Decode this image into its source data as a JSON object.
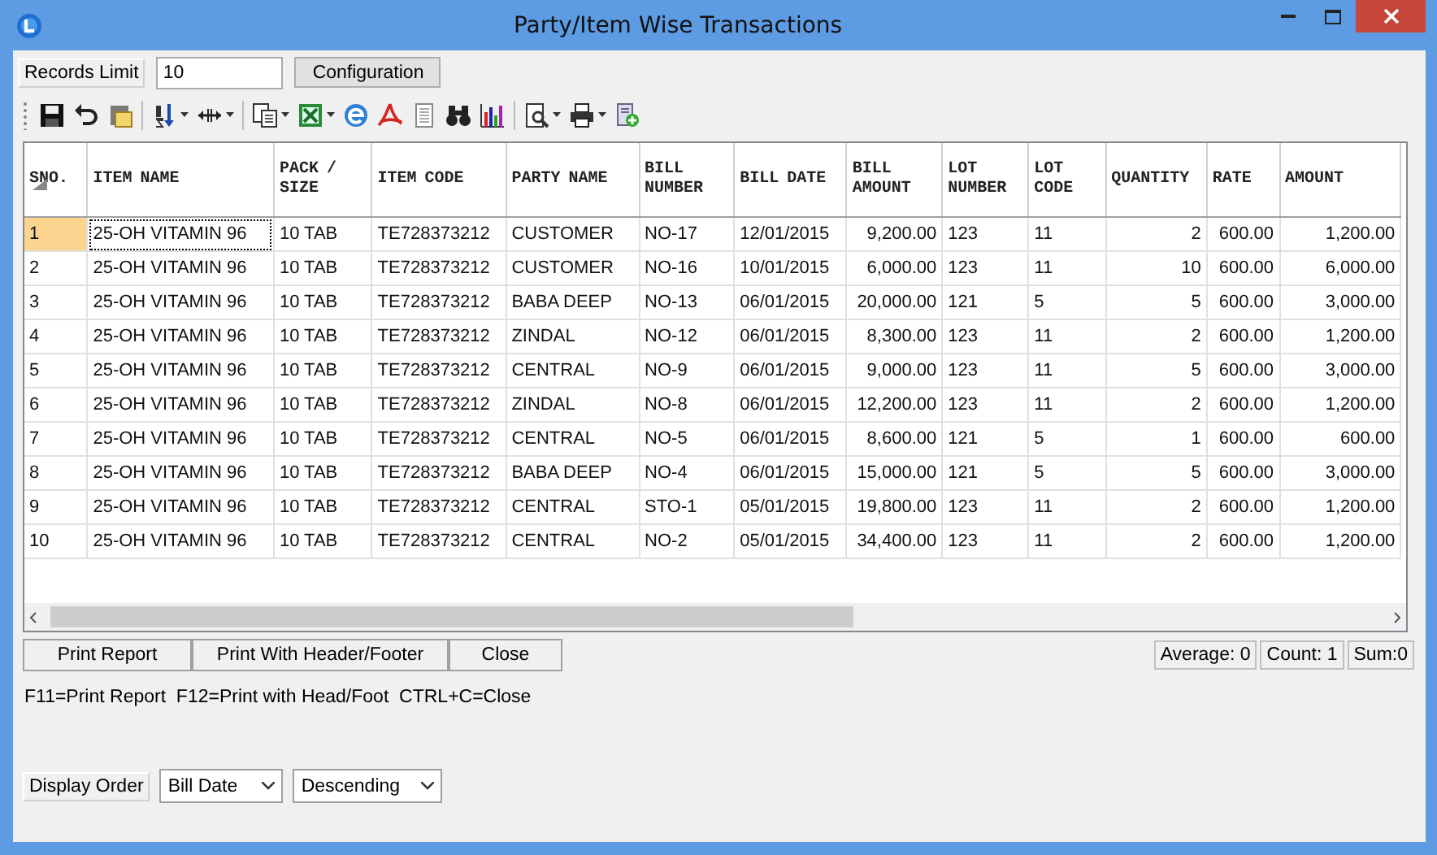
{
  "window": {
    "title": "Party/Item Wise Transactions"
  },
  "filter": {
    "label": "Records Limit",
    "value": "10",
    "button": "Configuration"
  },
  "toolbar": [
    {
      "kind": "save",
      "menu": false
    },
    {
      "kind": "undo",
      "menu": false
    },
    {
      "kind": "note",
      "menu": false
    },
    {
      "kind": "sort",
      "menu": true
    },
    {
      "kind": "width",
      "menu": true
    },
    {
      "kind": "copy",
      "menu": true
    },
    {
      "kind": "sheet",
      "menu": true
    },
    {
      "kind": "globe",
      "menu": false
    },
    {
      "kind": "pdf",
      "menu": false
    },
    {
      "kind": "doc",
      "menu": false
    },
    {
      "kind": "binoculars",
      "menu": false
    },
    {
      "kind": "chart",
      "menu": false
    },
    {
      "kind": "preview",
      "menu": true
    },
    {
      "kind": "printer",
      "menu": true
    },
    {
      "kind": "add",
      "menu": false
    }
  ],
  "table": {
    "columns": [
      {
        "label": "SNO.",
        "kind": "text",
        "sorted": true
      },
      {
        "label": "ITEM NAME",
        "kind": "text",
        "sorted": false
      },
      {
        "label": "PACK / SIZE",
        "kind": "text",
        "sorted": false
      },
      {
        "label": "ITEM CODE",
        "kind": "text",
        "sorted": false
      },
      {
        "label": "PARTY NAME",
        "kind": "text",
        "sorted": false
      },
      {
        "label": "BILL NUMBER",
        "kind": "text",
        "sorted": false
      },
      {
        "label": "BILL DATE",
        "kind": "text",
        "sorted": false
      },
      {
        "label": "BILL AMOUNT",
        "kind": "number",
        "sorted": false
      },
      {
        "label": "LOT NUMBER",
        "kind": "text",
        "sorted": false
      },
      {
        "label": "LOT CODE",
        "kind": "text",
        "sorted": false
      },
      {
        "label": "QUANTITY",
        "kind": "number",
        "sorted": false
      },
      {
        "label": "RATE",
        "kind": "number",
        "sorted": false
      },
      {
        "label": "AMOUNT",
        "kind": "number",
        "sorted": false
      }
    ],
    "rows": [
      {
        "selected": true,
        "cells": [
          "1",
          "25-OH VITAMIN 96",
          "10 TAB",
          "TE728373212",
          "CUSTOMER",
          "NO-17",
          "12/01/2015",
          "9,200.00",
          "123",
          "11",
          "2",
          "600.00",
          "1,200.00"
        ]
      },
      {
        "selected": false,
        "cells": [
          "2",
          "25-OH VITAMIN 96",
          "10 TAB",
          "TE728373212",
          "CUSTOMER",
          "NO-16",
          "10/01/2015",
          "6,000.00",
          "123",
          "11",
          "10",
          "600.00",
          "6,000.00"
        ]
      },
      {
        "selected": false,
        "cells": [
          "3",
          "25-OH VITAMIN 96",
          "10 TAB",
          "TE728373212",
          "BABA DEEP",
          "NO-13",
          "06/01/2015",
          "20,000.00",
          "121",
          "5",
          "5",
          "600.00",
          "3,000.00"
        ]
      },
      {
        "selected": false,
        "cells": [
          "4",
          "25-OH VITAMIN 96",
          "10 TAB",
          "TE728373212",
          "ZINDAL",
          "NO-12",
          "06/01/2015",
          "8,300.00",
          "123",
          "11",
          "2",
          "600.00",
          "1,200.00"
        ]
      },
      {
        "selected": false,
        "cells": [
          "5",
          "25-OH VITAMIN 96",
          "10 TAB",
          "TE728373212",
          "CENTRAL",
          "NO-9",
          "06/01/2015",
          "9,000.00",
          "123",
          "11",
          "5",
          "600.00",
          "3,000.00"
        ]
      },
      {
        "selected": false,
        "cells": [
          "6",
          "25-OH VITAMIN 96",
          "10 TAB",
          "TE728373212",
          "ZINDAL",
          "NO-8",
          "06/01/2015",
          "12,200.00",
          "123",
          "11",
          "2",
          "600.00",
          "1,200.00"
        ]
      },
      {
        "selected": false,
        "cells": [
          "7",
          "25-OH VITAMIN 96",
          "10 TAB",
          "TE728373212",
          "CENTRAL",
          "NO-5",
          "06/01/2015",
          "8,600.00",
          "121",
          "5",
          "1",
          "600.00",
          "600.00"
        ]
      },
      {
        "selected": false,
        "cells": [
          "8",
          "25-OH VITAMIN 96",
          "10 TAB",
          "TE728373212",
          "BABA DEEP",
          "NO-4",
          "06/01/2015",
          "15,000.00",
          "121",
          "5",
          "5",
          "600.00",
          "3,000.00"
        ]
      },
      {
        "selected": false,
        "cells": [
          "9",
          "25-OH VITAMIN 96",
          "10 TAB",
          "TE728373212",
          "CENTRAL",
          "STO-1",
          "05/01/2015",
          "19,800.00",
          "123",
          "11",
          "2",
          "600.00",
          "1,200.00"
        ]
      },
      {
        "selected": false,
        "cells": [
          "10",
          "25-OH VITAMIN 96",
          "10 TAB",
          "TE728373212",
          "CENTRAL",
          "NO-2",
          "05/01/2015",
          "34,400.00",
          "123",
          "11",
          "2",
          "600.00",
          "1,200.00"
        ]
      }
    ]
  },
  "buttons": [
    "Print Report",
    "Print With Header/Footer",
    "Close"
  ],
  "summary": [
    "Average: 0",
    "Count: 1",
    "Sum:0"
  ],
  "shortcuts": "F11=Print Report  F12=Print with Head/Foot  CTRL+C=Close",
  "display_order": {
    "label": "Display Order",
    "field": "Bill Date",
    "direction": "Descending"
  }
}
